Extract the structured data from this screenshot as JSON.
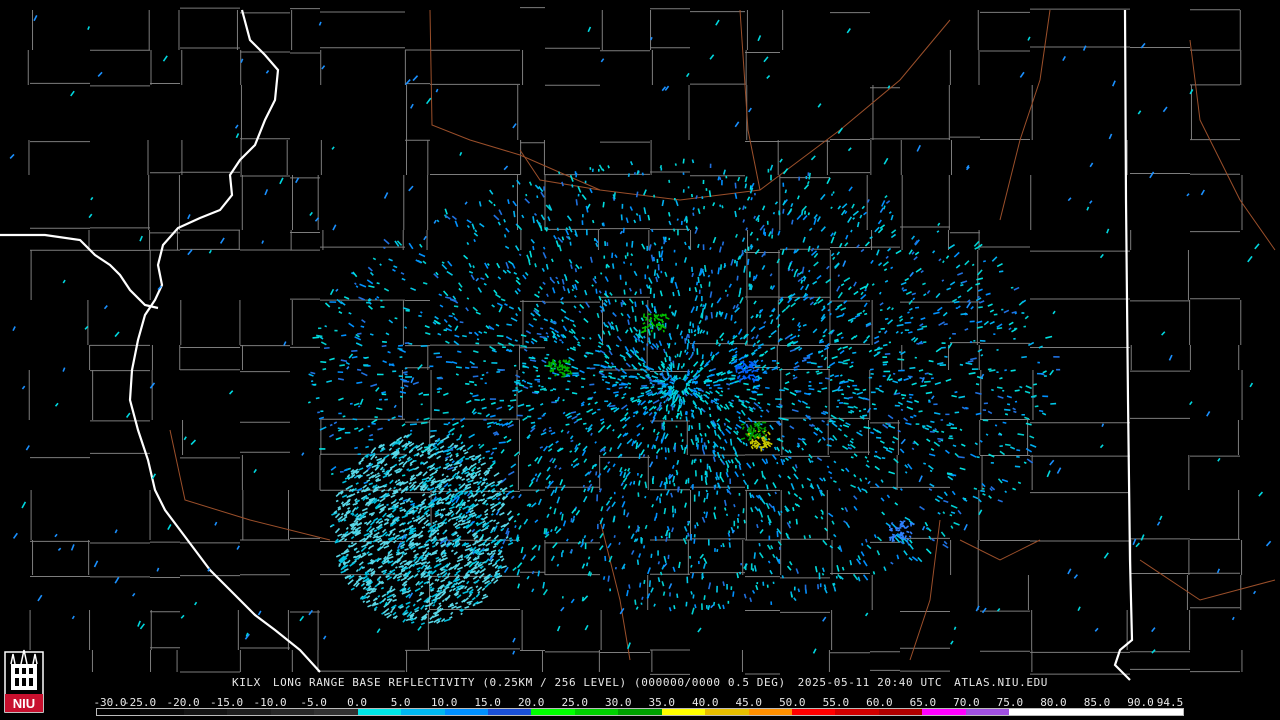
{
  "caption": {
    "station": "KILX",
    "product": "LONG RANGE BASE REFLECTIVITY (0.25KM / 256 LEVEL) (000000/0000 0.5 DEG)",
    "datetime": "2025-05-11 20:40 UTC",
    "site": "ATLAS.NIU.EDU"
  },
  "logo": {
    "text": "NIU",
    "icon": "niu-tower-logo"
  },
  "colorscale": {
    "labels": [
      "-30.0",
      "-25.0",
      "-20.0",
      "-15.0",
      "-10.0",
      "-5.0",
      "0.0",
      "5.0",
      "10.0",
      "15.0",
      "20.0",
      "25.0",
      "30.0",
      "35.0",
      "40.0",
      "45.0",
      "50.0",
      "55.0",
      "60.0",
      "65.0",
      "70.0",
      "75.0",
      "80.0",
      "85.0",
      "90.0",
      "94.5"
    ],
    "colors": [
      "#000000",
      "#0a0a0a",
      "#141414",
      "#1e1e1e",
      "#282828",
      "#323232",
      "#00e8e8",
      "#00b8f0",
      "#0090ff",
      "#1a50d8",
      "#00ff00",
      "#00d000",
      "#00a000",
      "#ffff00",
      "#e8c000",
      "#ff9000",
      "#ff0000",
      "#d00000",
      "#b00000",
      "#ff00ff",
      "#a050e0",
      "#ffffff",
      "#ffffff",
      "#ffffff",
      "#ffffff"
    ]
  },
  "map": {
    "radar_site": "KILX",
    "state_border_color": "#ffffff",
    "county_border_color": "#8a8a8a",
    "highway_color": "#a0522d"
  }
}
